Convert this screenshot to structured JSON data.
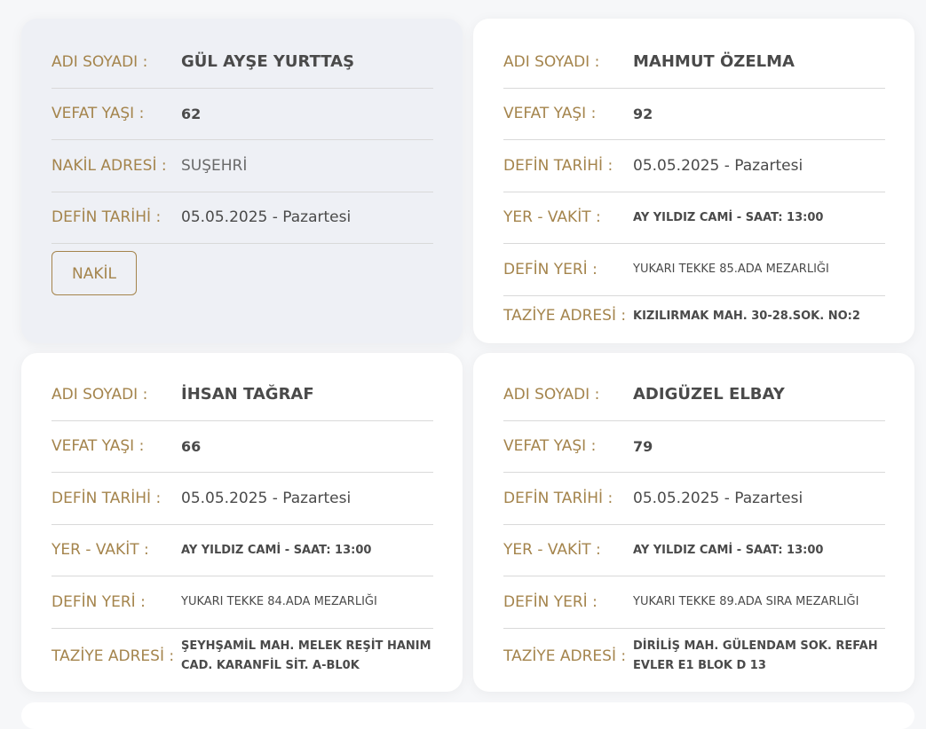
{
  "cards": [
    {
      "name_label": "ADI SOYADI :",
      "name": "GÜL AYŞE YURTTAŞ",
      "age_label": "VEFAT YAŞI :",
      "age": "62",
      "transfer_label": "NAKİL ADRESİ :",
      "transfer": "SUŞEHRİ",
      "burial_date_label": "DEFİN TARİHİ :",
      "burial_date": "05.05.2025 - Pazartesi",
      "button": "NAKİL"
    },
    {
      "name_label": "ADI SOYADI :",
      "name": "MAHMUT ÖZELMA",
      "age_label": "VEFAT YAŞI :",
      "age": "92",
      "burial_date_label": "DEFİN TARİHİ :",
      "burial_date": "05.05.2025 - Pazartesi",
      "place_time_label": "YER - VAKİT :",
      "place_time": "AY YILDIZ CAMİ - SAAT: 13:00",
      "burial_place_label": "DEFİN YERİ :",
      "burial_place": "YUKARI TEKKE 85.ADA MEZARLIĞI",
      "condolence_label": "TAZİYE ADRESİ :",
      "condolence": "KIZILIRMAK MAH. 30-28.SOK. NO:2"
    },
    {
      "name_label": "ADI SOYADI :",
      "name": "İHSAN TAĞRAF",
      "age_label": "VEFAT YAŞI :",
      "age": "66",
      "burial_date_label": "DEFİN TARİHİ :",
      "burial_date": "05.05.2025 - Pazartesi",
      "place_time_label": "YER - VAKİT :",
      "place_time": "AY YILDIZ CAMİ - SAAT: 13:00",
      "burial_place_label": "DEFİN YERİ :",
      "burial_place": "YUKARI TEKKE 84.ADA MEZARLIĞI",
      "condolence_label": "TAZİYE ADRESİ :",
      "condolence": "ŞEYHŞAMİL MAH. MELEK REŞİT HANIM CAD. KARANFİL SİT. A-BL0K"
    },
    {
      "name_label": "ADI SOYADI :",
      "name": "ADIGÜZEL ELBAY",
      "age_label": "VEFAT YAŞI :",
      "age": "79",
      "burial_date_label": "DEFİN TARİHİ :",
      "burial_date": "05.05.2025 - Pazartesi",
      "place_time_label": "YER - VAKİT :",
      "place_time": "AY YILDIZ CAMİ - SAAT: 13:00",
      "burial_place_label": "DEFİN YERİ :",
      "burial_place": "YUKARI TEKKE 89.ADA SIRA MEZARLIĞI",
      "condolence_label": "TAZİYE ADRESİ :",
      "condolence": "DİRİLİŞ MAH. GÜLENDAM SOK. REFAH EVLER E1 BLOK D 13"
    }
  ],
  "colors": {
    "accent": "#a4844c",
    "text": "#4a4a4a",
    "divider": "#d9d9d9",
    "card_highlight": "#eef0f5"
  }
}
